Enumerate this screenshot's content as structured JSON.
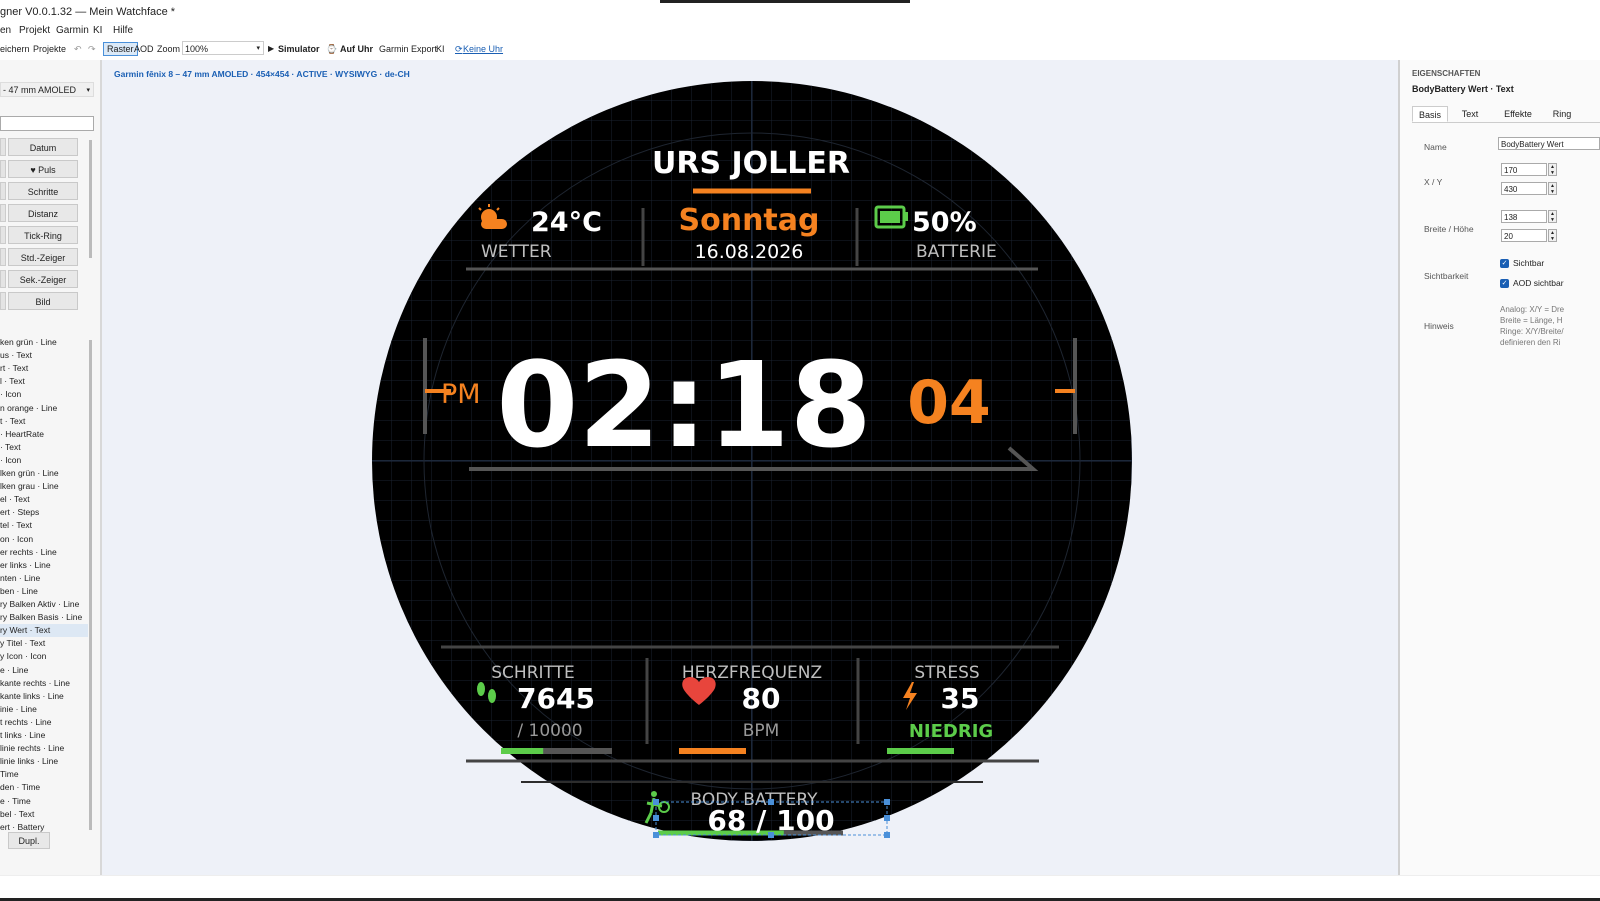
{
  "window": {
    "title": "gner V0.0.1.32 — Mein Watchface *"
  },
  "menu": [
    "en",
    "Projekt",
    "Garmin",
    "KI",
    "Hilfe"
  ],
  "toolbar": {
    "save": "eichern",
    "projects": "Projekte",
    "undo": "↶",
    "redo": "↷",
    "raster": "Raster",
    "aod": "AOD",
    "zoom_label": "Zoom",
    "zoom_value": "100%",
    "simulator": "Simulator",
    "on_watch": "Auf Uhr",
    "garmin_export": "Garmin Export",
    "ki": "KI",
    "no_watch": "Keine Uhr"
  },
  "left": {
    "device_select": "- 47 mm AMOLED",
    "elements": [
      "Datum",
      "♥ Puls",
      "Schritte",
      "Distanz",
      "Tick-Ring",
      "Std.-Zeiger",
      "Sek.-Zeiger",
      "Bild"
    ],
    "layers": [
      "ken grün  ·  Line",
      "us  ·  Text",
      "rt  ·  Text",
      "l  ·  Text",
      "  ·  Icon",
      "n orange  ·  Line",
      "t  ·  Text",
      "  ·  HeartRate",
      "  ·  Text",
      "  ·  Icon",
      "lken grün  ·  Line",
      "lken grau  ·  Line",
      "el  ·  Text",
      "ert  ·  Steps",
      "tel  ·  Text",
      "on  ·  Icon",
      "er rechts  ·  Line",
      "er links  ·  Line",
      "nten  ·  Line",
      "ben  ·  Line",
      "ry Balken Aktiv  ·  Line",
      "ry Balken Basis  ·  Line",
      "ry Wert  ·  Text",
      "y Titel  ·  Text",
      "y Icon  ·  Icon",
      "e  ·  Line",
      "kante rechts  ·  Line",
      "kante links  ·  Line",
      "inie  ·  Line",
      "t rechts  ·  Line",
      "t links  ·  Line",
      "linie rechts  ·  Line",
      "linie links  ·  Line",
      "  Time",
      "den  ·  Time",
      "e  ·  Time",
      "bel  ·  Text",
      "ert  ·  Battery"
    ],
    "selected_layer_index": 22,
    "duplicate": "Dupl."
  },
  "canvas": {
    "device_info": "Garmin fēnix 8 – 47 mm AMOLED  ·  454×454  ·  ACTIVE  ·  WYSIWYG  ·  de-CH"
  },
  "watch": {
    "name": "URS JOLLER",
    "temp": "24°C",
    "weather_label": "WETTER",
    "day": "Sonntag",
    "date": "16.08.2026",
    "battery": "50%",
    "battery_label": "BATTERIE",
    "ampm": "PM",
    "time": "02:18",
    "seconds": "04",
    "steps_label": "SCHRITTE",
    "steps": "7645",
    "steps_goal": "/ 10000",
    "steps_progress": 0.38,
    "hr_label": "HERZFREQUENZ",
    "hr": "80",
    "hr_unit": "BPM",
    "stress_label": "STRESS",
    "stress": "35",
    "stress_level": "NIEDRIG",
    "bb_label": "BODY BATTERY",
    "bb_value": "68 / 100",
    "bb_progress": 0.68,
    "colors": {
      "accent": "#f58220",
      "green": "#5ccc4a",
      "heart": "#e8453c",
      "face": "#000000"
    }
  },
  "props": {
    "header": "EIGENSCHAFTEN",
    "subtitle": "BodyBattery Wert · Text",
    "tabs": [
      "Basis",
      "Text",
      "Effekte",
      "Ring"
    ],
    "name_label": "Name",
    "name_value": "BodyBattery Wert",
    "xy_label": "X / Y",
    "x": "170",
    "y": "430",
    "wh_label": "Breite / Höhe",
    "w": "138",
    "h": "20",
    "visibility_label": "Sichtbarkeit",
    "visible": "Sichtbar",
    "aod_visible": "AOD sichtbar",
    "hint_label": "Hinweis",
    "hint_lines": [
      "Analog: X/Y = Dre",
      "Breite = Länge, H",
      "Ringe: X/Y/Breite/",
      "definieren den Ri"
    ]
  }
}
